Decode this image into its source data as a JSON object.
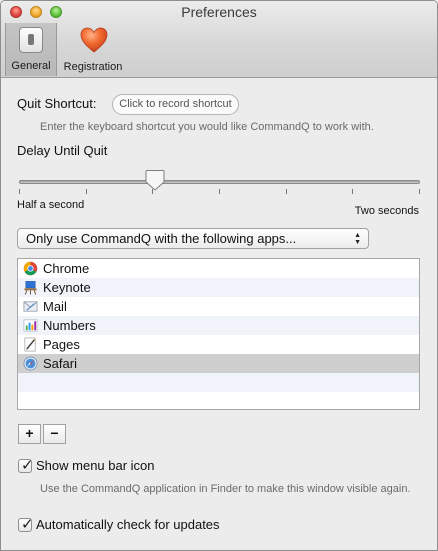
{
  "window": {
    "title": "Preferences"
  },
  "toolbar": {
    "general_label": "General",
    "registration_label": "Registration",
    "general_icon": "switch-icon",
    "registration_icon": "heart-icon"
  },
  "quit_shortcut": {
    "label": "Quit Shortcut:",
    "button_label": "Click to record shortcut",
    "help_text": "Enter the keyboard shortcut you would like CommandQ to work with."
  },
  "delay": {
    "label": "Delay Until Quit",
    "min_label": "Half a second",
    "max_label": "Two seconds",
    "value_fraction": 0.34
  },
  "mode_popup": {
    "selected": "Only use CommandQ with the following apps..."
  },
  "apps": [
    {
      "name": "Chrome",
      "icon": "chrome-icon",
      "selected": false
    },
    {
      "name": "Keynote",
      "icon": "keynote-icon",
      "selected": false
    },
    {
      "name": "Mail",
      "icon": "mail-icon",
      "selected": false
    },
    {
      "name": "Numbers",
      "icon": "numbers-icon",
      "selected": false
    },
    {
      "name": "Pages",
      "icon": "pages-icon",
      "selected": false
    },
    {
      "name": "Safari",
      "icon": "safari-icon",
      "selected": true
    }
  ],
  "list_buttons": {
    "add_label": "+",
    "remove_label": "−"
  },
  "show_menu_bar": {
    "label": "Show menu bar icon",
    "checked": true,
    "help_text": "Use the CommandQ application in Finder to make this window visible again."
  },
  "auto_update": {
    "label": "Automatically check for updates",
    "checked": true
  },
  "colors": {
    "selection": "#cfcfcf",
    "heart": "#f26a2e",
    "background": "#ececec"
  }
}
